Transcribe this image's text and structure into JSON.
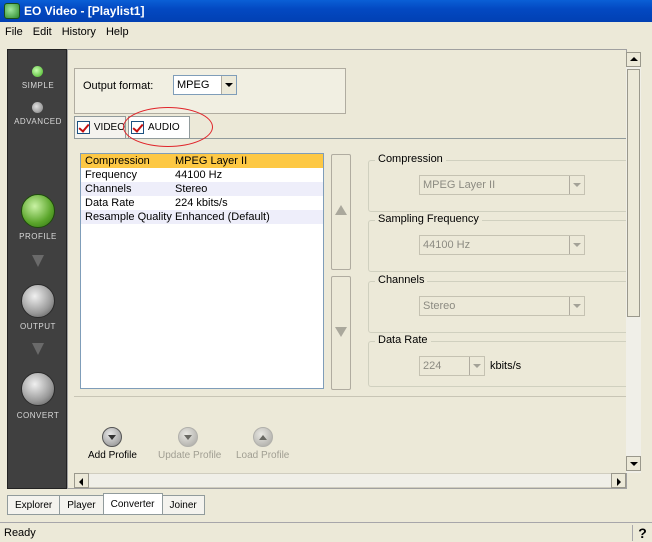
{
  "window": {
    "title": "EO Video - [Playlist1]"
  },
  "menu": [
    "File",
    "Edit",
    "History",
    "Help"
  ],
  "sidebar": {
    "modes": [
      {
        "label": "SIMPLE",
        "active": true
      },
      {
        "label": "ADVANCED",
        "active": false
      }
    ],
    "steps": [
      {
        "label": "PROFILE",
        "color": "#6fbf3a"
      },
      {
        "label": "OUTPUT",
        "color": "#9a9a9a"
      },
      {
        "label": "CONVERT",
        "color": "#9a9a9a"
      }
    ]
  },
  "output_format": {
    "label": "Output format:",
    "value": "MPEG"
  },
  "tabs": [
    {
      "label": "VIDEO",
      "checked": true
    },
    {
      "label": "AUDIO",
      "checked": true,
      "active": true
    }
  ],
  "settings_list": [
    {
      "key": "Compression",
      "value": "MPEG Layer II"
    },
    {
      "key": "Frequency",
      "value": "44100 Hz"
    },
    {
      "key": "Channels",
      "value": "Stereo"
    },
    {
      "key": "Data Rate",
      "value": "224 kbits/s"
    },
    {
      "key": "Resample Quality",
      "value": "Enhanced (Default)"
    }
  ],
  "groups": {
    "compression": {
      "label": "Compression",
      "value": "MPEG Layer II"
    },
    "sampling": {
      "label": "Sampling Frequency",
      "value": "44100 Hz"
    },
    "channels": {
      "label": "Channels",
      "value": "Stereo"
    },
    "datarate": {
      "label": "Data Rate",
      "value": "224",
      "unit": "kbits/s"
    }
  },
  "profile_actions": {
    "add": "Add Profile",
    "update": "Update Profile",
    "load": "Load Profile"
  },
  "bottom_tabs": [
    "Explorer",
    "Player",
    "Converter",
    "Joiner"
  ],
  "status": {
    "text": "Ready",
    "help": "?"
  }
}
